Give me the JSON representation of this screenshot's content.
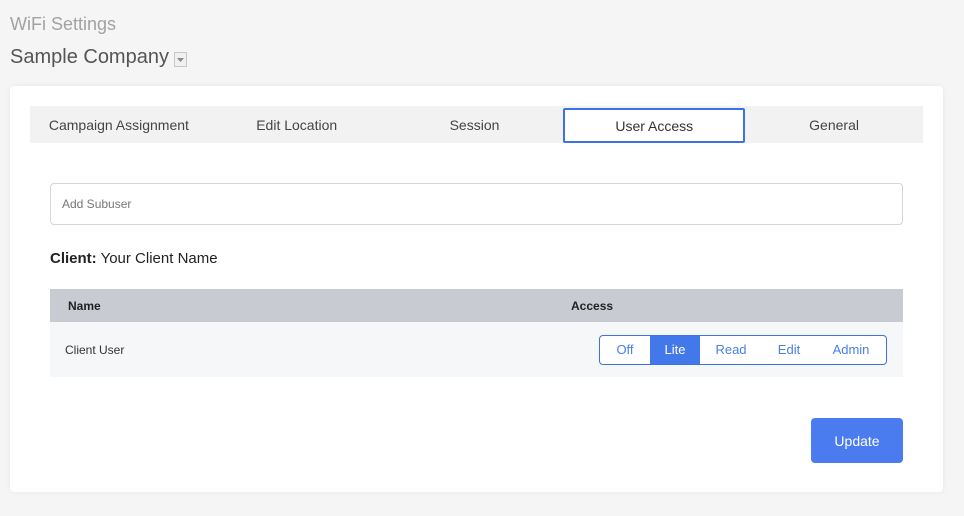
{
  "page": {
    "title": "WiFi Settings",
    "company": "Sample Company"
  },
  "tabs": [
    {
      "label": "Campaign Assignment",
      "active": false
    },
    {
      "label": "Edit Location",
      "active": false
    },
    {
      "label": "Session",
      "active": false
    },
    {
      "label": "User Access",
      "active": true
    },
    {
      "label": "General",
      "active": false
    }
  ],
  "subuser": {
    "placeholder": "Add Subuser",
    "value": ""
  },
  "client": {
    "label": "Client:",
    "name": "Your Client Name"
  },
  "table": {
    "columns": [
      "Name",
      "Access"
    ],
    "rows": [
      {
        "name": "Client User",
        "access": "Lite"
      }
    ]
  },
  "access_levels": [
    "Off",
    "Lite",
    "Read",
    "Edit",
    "Admin"
  ],
  "actions": {
    "update_label": "Update"
  },
  "colors": {
    "accent": "#3b72e6",
    "button": "#4a7cf0",
    "header_bg": "#c8ccd2"
  },
  "icons": {
    "company_dropdown": "chevron-down-icon"
  }
}
